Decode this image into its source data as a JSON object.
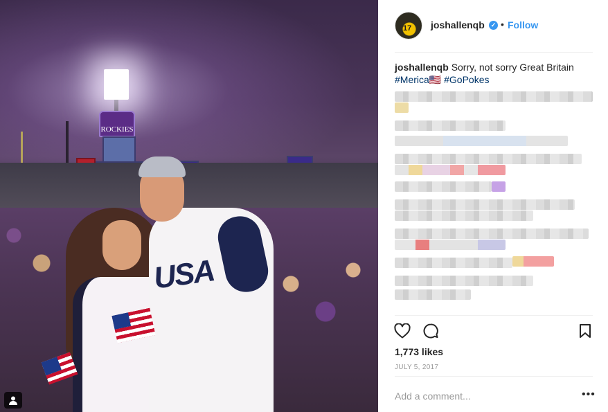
{
  "post": {
    "username": "joshallenqb",
    "verified_icon": "verified-badge-icon",
    "separator": "•",
    "follow_label": "Follow",
    "avatar_text": "17",
    "caption": {
      "username": "joshallenqb",
      "text": "Sorry, not sorry Great Britain",
      "hashtag1": "#Merica🇺🇸",
      "hashtag2": "#GoPokes"
    },
    "likes": "1,773 likes",
    "date": "July 5, 2017",
    "comment_placeholder": "Add a comment...",
    "more_label": "•••"
  },
  "photo": {
    "scoreboard_sign": "ROCKIES",
    "jersey_text": "USA",
    "tag_icon": "person-tag-icon"
  },
  "icons": {
    "like": "heart-icon",
    "comment": "comment-bubble-icon",
    "save": "bookmark-icon"
  },
  "colors": {
    "link": "#3897f0",
    "hashtag": "#003569",
    "muted": "#999999"
  }
}
